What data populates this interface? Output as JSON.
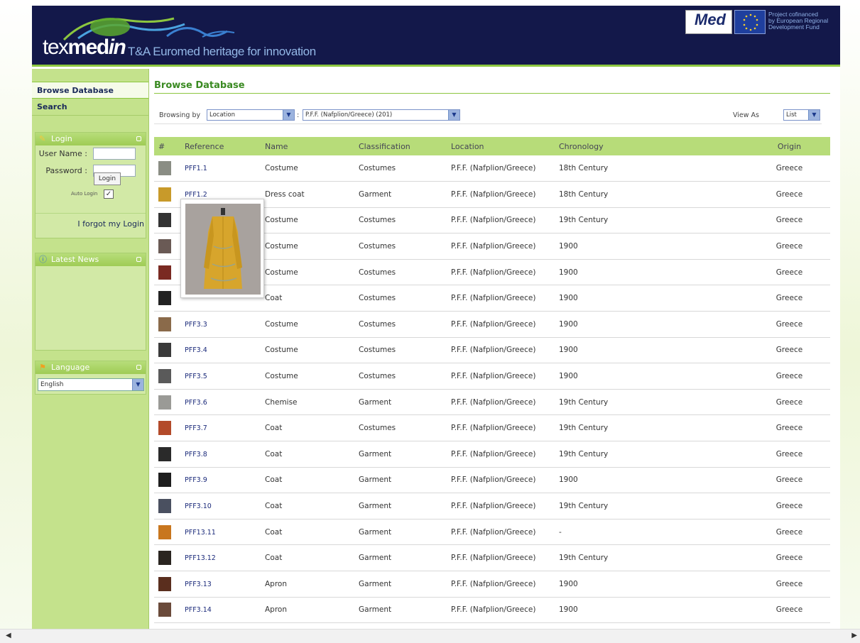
{
  "header": {
    "logo_text_prefix": "tex",
    "logo_text_med": "med",
    "logo_text_in": "in",
    "tagline": "T&A Euromed heritage for innovation",
    "med_logo_text": "Med",
    "eu_text": [
      "Project cofinanced",
      "by European Regional",
      "Development Fund"
    ]
  },
  "sidebar": {
    "nav": [
      {
        "label": "Browse Database"
      },
      {
        "label": "Search"
      }
    ],
    "login_panel": {
      "title": "Login",
      "username_label": "User Name :",
      "password_label": "Password :",
      "login_button": "Login",
      "auto_login_label": "Auto Login",
      "forgot_link": "I forgot my Login"
    },
    "news_panel": {
      "title": "Latest News"
    },
    "language_panel": {
      "title": "Language",
      "selected": "English"
    }
  },
  "main": {
    "title": "Browse Database",
    "browsing_label": "Browsing by",
    "browse_by_value": "Location",
    "location_value": "P.F.F. (Nafplion/Greece) (201)",
    "view_as_label": "View As",
    "view_as_value": "List"
  },
  "table": {
    "columns": [
      "#",
      "Reference",
      "Name",
      "Classification",
      "Location",
      "Chronology",
      "Origin"
    ],
    "rows": [
      {
        "ref": "PFF1.1",
        "name": "Costume",
        "class": "Costumes",
        "loc": "P.F.F. (Nafplion/Greece)",
        "chron": "18th Century",
        "origin": "Greece",
        "thumb": "#8a8d84"
      },
      {
        "ref": "PFF1.2",
        "name": "Dress coat",
        "class": "Garment",
        "loc": "P.F.F. (Nafplion/Greece)",
        "chron": "18th Century",
        "origin": "Greece",
        "thumb": "#c89a2a"
      },
      {
        "ref": "",
        "name": "Costume",
        "class": "Costumes",
        "loc": "P.F.F. (Nafplion/Greece)",
        "chron": "19th Century",
        "origin": "Greece",
        "thumb": "#333333"
      },
      {
        "ref": "",
        "name": "Costume",
        "class": "Costumes",
        "loc": "P.F.F. (Nafplion/Greece)",
        "chron": "1900",
        "origin": "Greece",
        "thumb": "#6a5a55"
      },
      {
        "ref": "",
        "name": "Costume",
        "class": "Costumes",
        "loc": "P.F.F. (Nafplion/Greece)",
        "chron": "1900",
        "origin": "Greece",
        "thumb": "#7a2a22"
      },
      {
        "ref": "",
        "name": "Coat",
        "class": "Costumes",
        "loc": "P.F.F. (Nafplion/Greece)",
        "chron": "1900",
        "origin": "Greece",
        "thumb": "#222222"
      },
      {
        "ref": "PFF3.3",
        "name": "Costume",
        "class": "Costumes",
        "loc": "P.F.F. (Nafplion/Greece)",
        "chron": "1900",
        "origin": "Greece",
        "thumb": "#8a6a4a"
      },
      {
        "ref": "PFF3.4",
        "name": "Costume",
        "class": "Costumes",
        "loc": "P.F.F. (Nafplion/Greece)",
        "chron": "1900",
        "origin": "Greece",
        "thumb": "#3a3a3a"
      },
      {
        "ref": "PFF3.5",
        "name": "Costume",
        "class": "Costumes",
        "loc": "P.F.F. (Nafplion/Greece)",
        "chron": "1900",
        "origin": "Greece",
        "thumb": "#5a5a5a"
      },
      {
        "ref": "PFF3.6",
        "name": "Chemise",
        "class": "Garment",
        "loc": "P.F.F. (Nafplion/Greece)",
        "chron": "19th Century",
        "origin": "Greece",
        "thumb": "#9a9a96"
      },
      {
        "ref": "PFF3.7",
        "name": "Coat",
        "class": "Costumes",
        "loc": "P.F.F. (Nafplion/Greece)",
        "chron": "19th Century",
        "origin": "Greece",
        "thumb": "#b34a2a"
      },
      {
        "ref": "PFF3.8",
        "name": "Coat",
        "class": "Garment",
        "loc": "P.F.F. (Nafplion/Greece)",
        "chron": "19th Century",
        "origin": "Greece",
        "thumb": "#2a2a2a"
      },
      {
        "ref": "PFF3.9",
        "name": "Coat",
        "class": "Garment",
        "loc": "P.F.F. (Nafplion/Greece)",
        "chron": "1900",
        "origin": "Greece",
        "thumb": "#1e1e1e"
      },
      {
        "ref": "PFF3.10",
        "name": "Coat",
        "class": "Garment",
        "loc": "P.F.F. (Nafplion/Greece)",
        "chron": "19th Century",
        "origin": "Greece",
        "thumb": "#4a5060"
      },
      {
        "ref": "PFF13.11",
        "name": "Coat",
        "class": "Garment",
        "loc": "P.F.F. (Nafplion/Greece)",
        "chron": "-",
        "origin": "Greece",
        "thumb": "#c8761e"
      },
      {
        "ref": "PFF13.12",
        "name": "Coat",
        "class": "Garment",
        "loc": "P.F.F. (Nafplion/Greece)",
        "chron": "19th Century",
        "origin": "Greece",
        "thumb": "#2a2520"
      },
      {
        "ref": "PFF3.13",
        "name": "Apron",
        "class": "Garment",
        "loc": "P.F.F. (Nafplion/Greece)",
        "chron": "1900",
        "origin": "Greece",
        "thumb": "#5a2e1e"
      },
      {
        "ref": "PFF3.14",
        "name": "Apron",
        "class": "Garment",
        "loc": "P.F.F. (Nafplion/Greece)",
        "chron": "1900",
        "origin": "Greece",
        "thumb": "#6a4a3a"
      }
    ]
  }
}
